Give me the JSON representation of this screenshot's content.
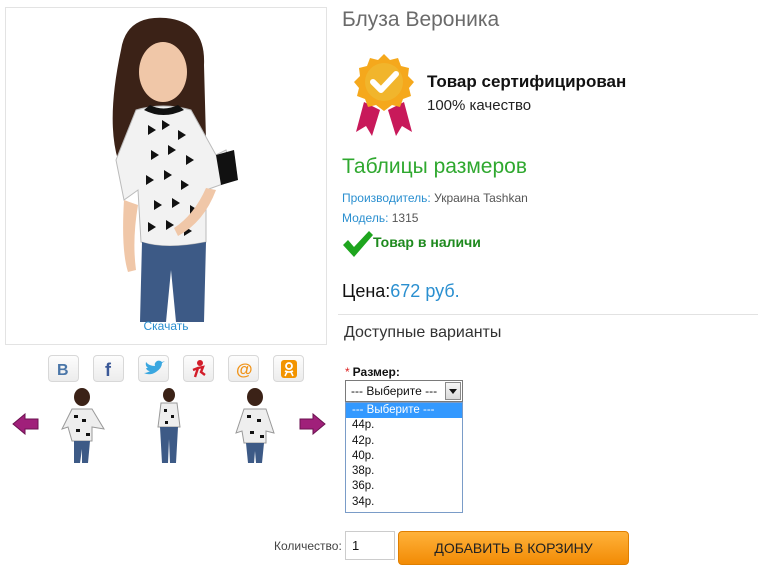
{
  "product": {
    "title": "Блуза Вероника",
    "download_link": "Скачать",
    "certified_title": "Товар сертифицирован",
    "certified_sub": "100% качество",
    "size_tables_link": "Таблицы размеров",
    "manufacturer_label": "Производитель:",
    "manufacturer_value": "Украина Tashkan",
    "model_label": "Модель:",
    "model_value": "1315",
    "stock_text": "Товар в наличи",
    "price_label": "Цена:",
    "price_value": "672 руб."
  },
  "share_icons": [
    "vk-icon",
    "facebook-icon",
    "twitter-icon",
    "surfingbird-icon",
    "mailru-icon",
    "odnoklassniki-icon"
  ],
  "options": {
    "heading": "Доступные варианты",
    "size_label": "Размер:",
    "required_mark": "*",
    "selected": "--- Выберите ---",
    "items": [
      "--- Выберите ---",
      "44р.",
      "42р.",
      "40р.",
      "38р.",
      "36р.",
      "34р."
    ]
  },
  "cart": {
    "qty_label": "Количество:",
    "qty_value": "1",
    "add_button": "ДОБАВИТЬ В КОРЗИНУ"
  },
  "colors": {
    "link_blue": "#2a8fd0",
    "green": "#2fa82f",
    "orange": "#f28b05",
    "arrow_purple": "#a0207a"
  }
}
